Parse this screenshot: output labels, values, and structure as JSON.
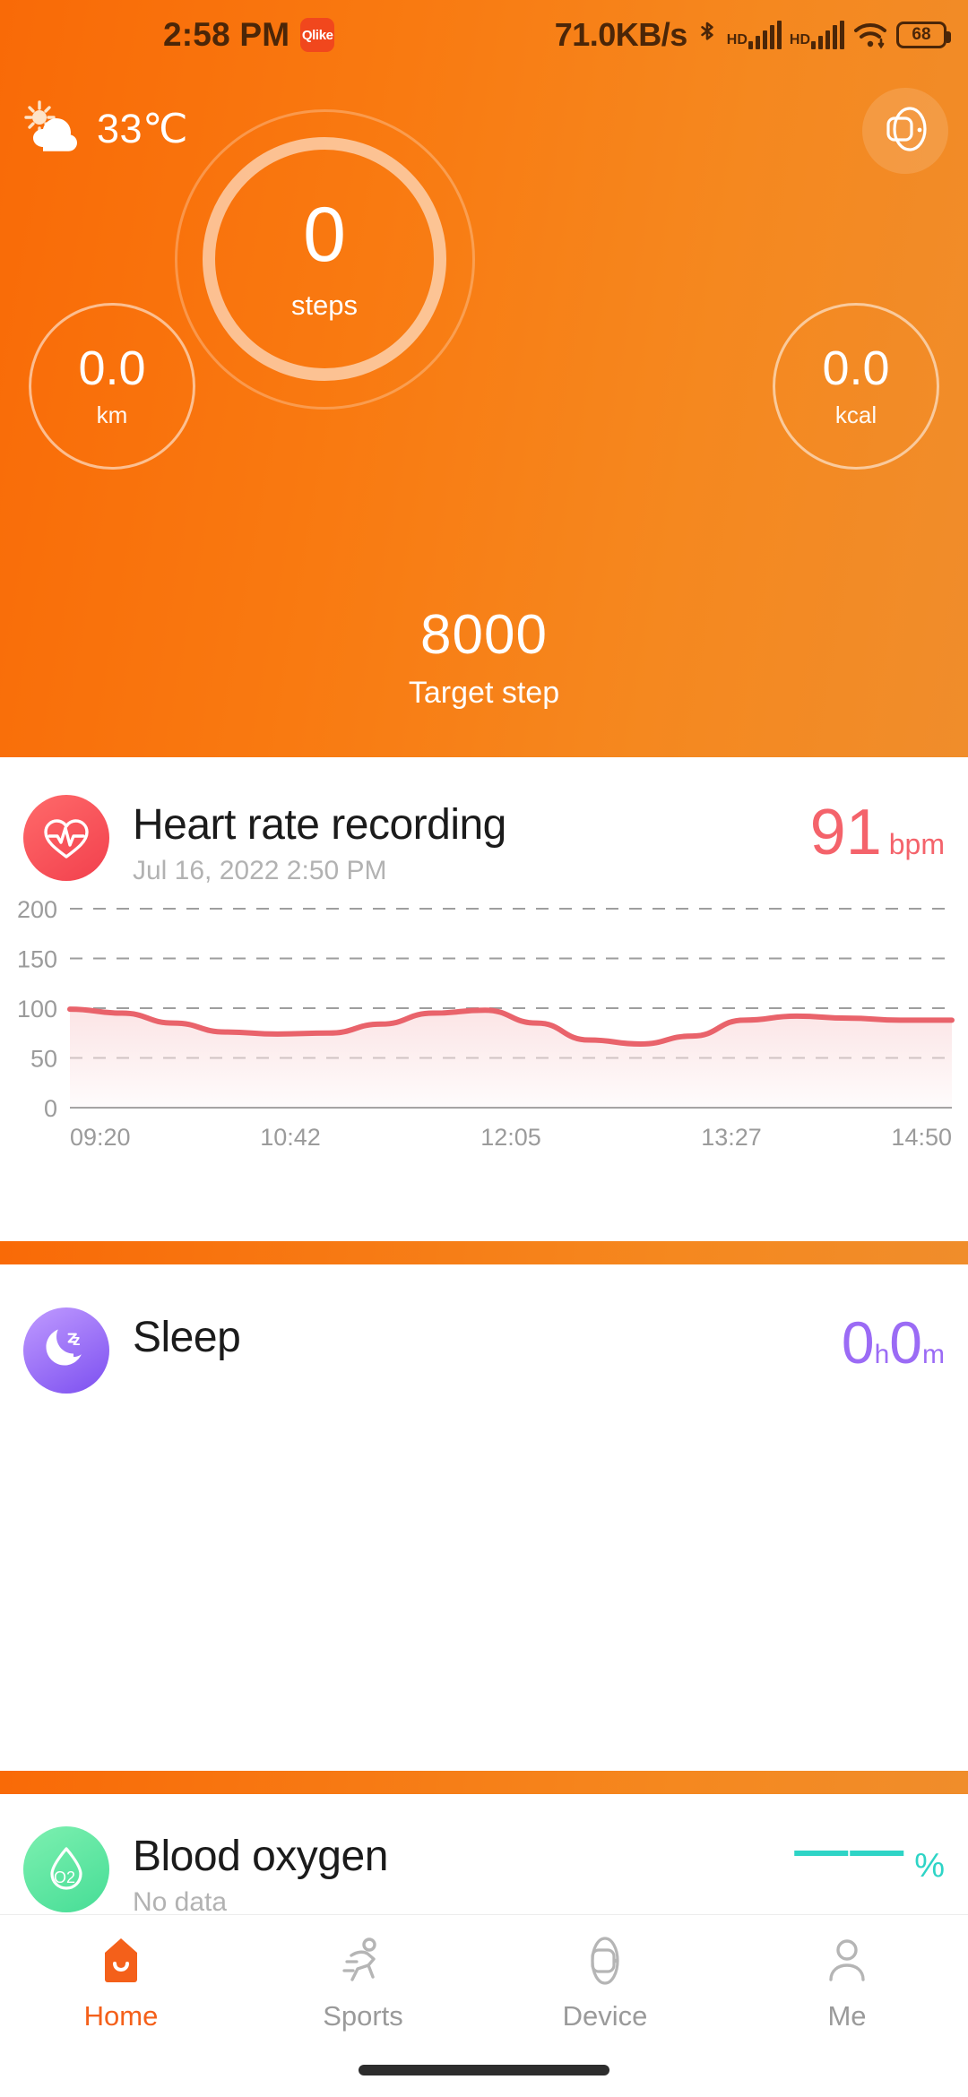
{
  "status_bar": {
    "time": "2:58 PM",
    "app_badge": "Qlike",
    "network_speed": "71.0KB/s",
    "bluetooth_icon": "bluetooth-icon",
    "sim1_hd": "HD",
    "sim2_hd": "HD",
    "wifi_icon": "wifi-icon",
    "battery_level": "68"
  },
  "header": {
    "weather_icon": "sun-behind-cloud-icon",
    "temperature": "33℃",
    "device_icon": "smartwatch-icon",
    "steps_value": "0",
    "steps_label": "steps",
    "distance_value": "0.0",
    "distance_label": "km",
    "calories_value": "0.0",
    "calories_label": "kcal",
    "target_value": "8000",
    "target_label": "Target step",
    "accent_color": "#f97a11"
  },
  "heart_rate": {
    "icon": "heart-pulse-icon",
    "title": "Heart rate recording",
    "timestamp": "Jul 16, 2022 2:50 PM",
    "value": "91",
    "unit": "bpm",
    "color": "#f4636b"
  },
  "sleep": {
    "icon": "moon-z-icon",
    "title": "Sleep",
    "hours": "0",
    "hours_unit": "h",
    "minutes": "0",
    "minutes_unit": "m",
    "color": "#9b6bf5"
  },
  "blood_oxygen": {
    "icon": "blood-drop-o2-icon",
    "title": "Blood oxygen",
    "subtitle": "No data",
    "value": "——",
    "unit": "%",
    "color": "#2ed4c6"
  },
  "bottom_nav": {
    "items": [
      {
        "label": "Home",
        "icon": "home-icon",
        "active": true
      },
      {
        "label": "Sports",
        "icon": "running-icon",
        "active": false
      },
      {
        "label": "Device",
        "icon": "watch-icon",
        "active": false
      },
      {
        "label": "Me",
        "icon": "person-icon",
        "active": false
      }
    ]
  },
  "chart_data": {
    "type": "area",
    "title": "Heart rate recording",
    "xlabel": "",
    "ylabel": "bpm",
    "ylim": [
      0,
      200
    ],
    "yticks": [
      0,
      50,
      100,
      150,
      200
    ],
    "xticks": [
      "09:20",
      "10:42",
      "12:05",
      "13:27",
      "14:50"
    ],
    "grid": true,
    "line_color": "#e9636b",
    "fill_color": "#fbe3e4",
    "x": [
      "09:20",
      "09:40",
      "10:00",
      "10:20",
      "10:42",
      "11:00",
      "11:20",
      "11:40",
      "12:05",
      "12:25",
      "12:45",
      "13:05",
      "13:27",
      "13:45",
      "14:05",
      "14:20",
      "14:35",
      "14:50"
    ],
    "values": [
      99,
      95,
      85,
      76,
      74,
      75,
      84,
      95,
      98,
      85,
      68,
      64,
      72,
      88,
      92,
      90,
      88,
      88
    ],
    "series": [
      {
        "name": "Heart rate",
        "values": [
          99,
          95,
          85,
          76,
          74,
          75,
          84,
          95,
          98,
          85,
          68,
          64,
          72,
          88,
          92,
          90,
          88,
          88
        ]
      }
    ]
  }
}
